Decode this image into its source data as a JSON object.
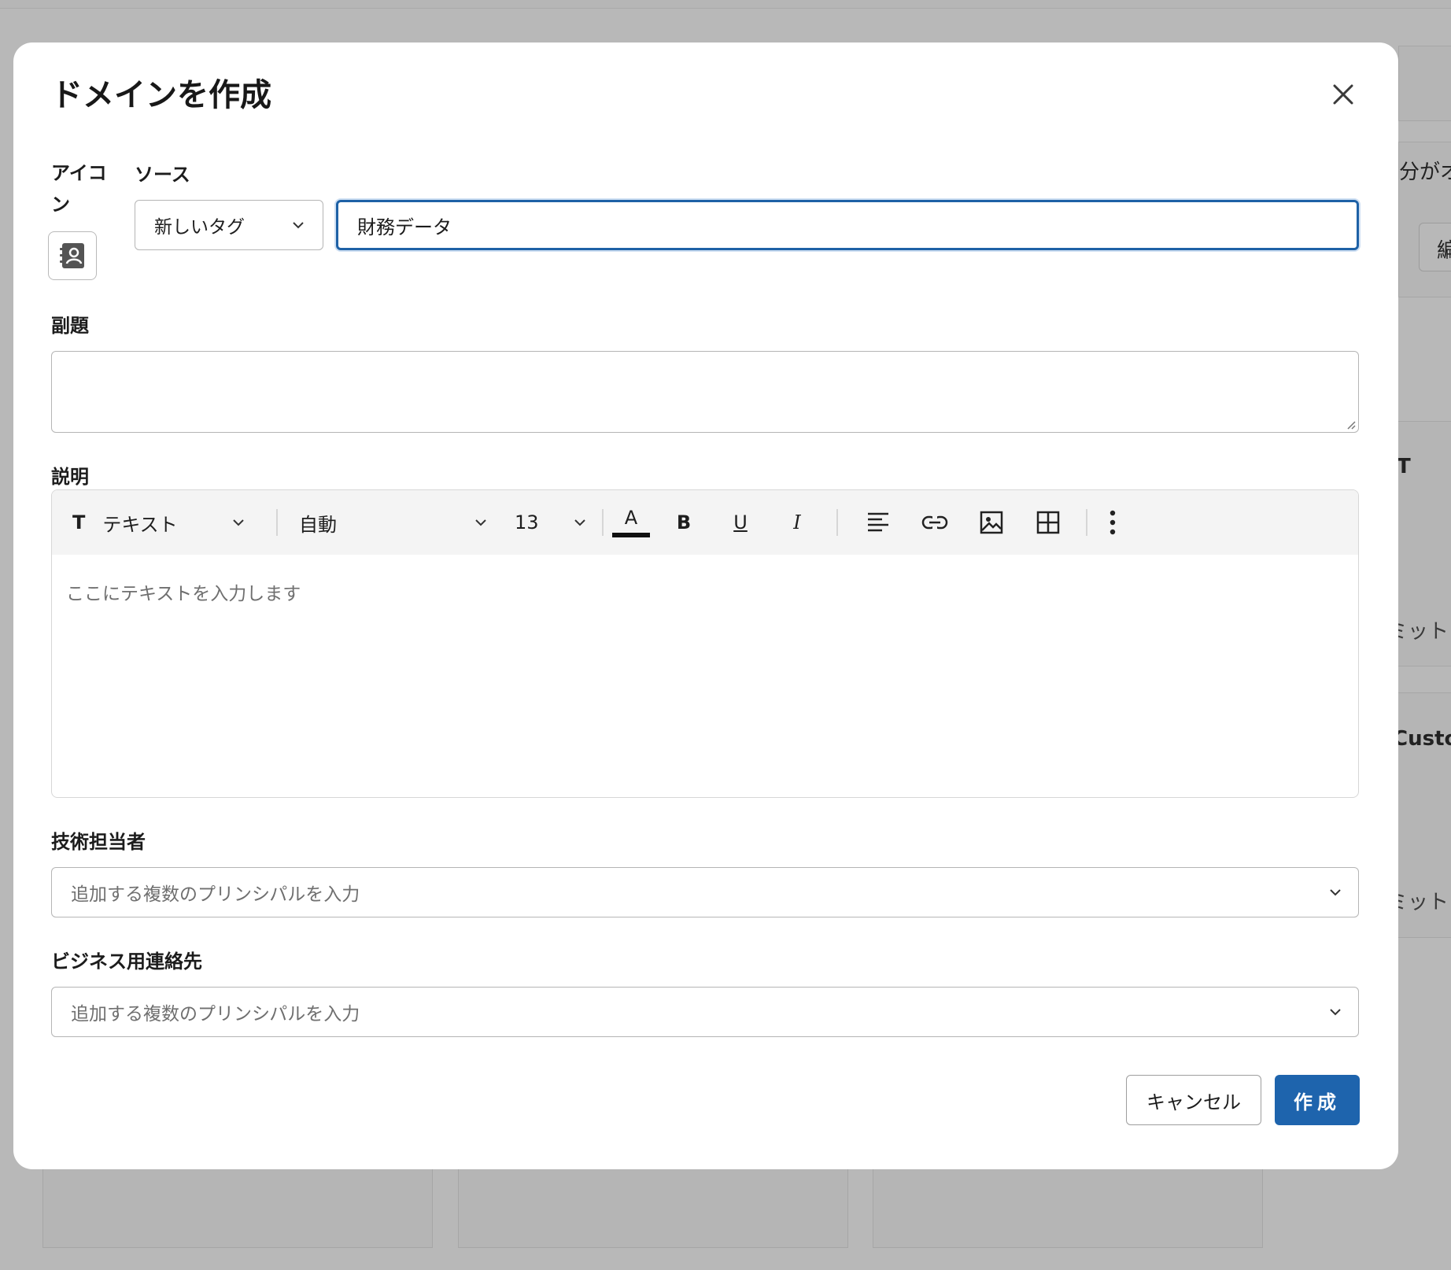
{
  "background": {
    "snippets": {
      "owner_fragment": "分がオ",
      "edit_fragment": "編",
      "t_fragment": "T",
      "set_fragment_1": "ミット",
      "customer_fragment": "Custon",
      "set_fragment_2": "ミット"
    }
  },
  "modal": {
    "title": "ドメインを作成",
    "icon_label": "アイコン",
    "source_label": "ソース",
    "source_select": {
      "value": "新しいタグ"
    },
    "name_input": {
      "value": "財務データ"
    },
    "subtitle_label": "副題",
    "description_label": "説明",
    "toolbar": {
      "text_style": "テキスト",
      "font": "自動",
      "font_size": "13",
      "text_color_glyph": "A",
      "bold_glyph": "B",
      "underline_glyph": "U",
      "italic_glyph": "I",
      "text_style_glyph": "T"
    },
    "editor_placeholder": "ここにテキストを入力します",
    "technical_owner_label": "技術担当者",
    "technical_owner_placeholder": "追加する複数のプリンシパルを入力",
    "business_contact_label": "ビジネス用連絡先",
    "business_contact_placeholder": "追加する複数のプリンシパルを入力",
    "cancel_label": "キャンセル",
    "create_label": "作成"
  },
  "colors": {
    "primary": "#1e64ad",
    "focus_border": "#1e61a6",
    "overlay": "#b8b8b8"
  },
  "icons": [
    "close-icon",
    "contact-book-icon",
    "chevron-down-icon",
    "align-left-icon",
    "link-icon",
    "image-icon",
    "table-icon",
    "more-vertical-icon",
    "resize-handle-icon"
  ]
}
